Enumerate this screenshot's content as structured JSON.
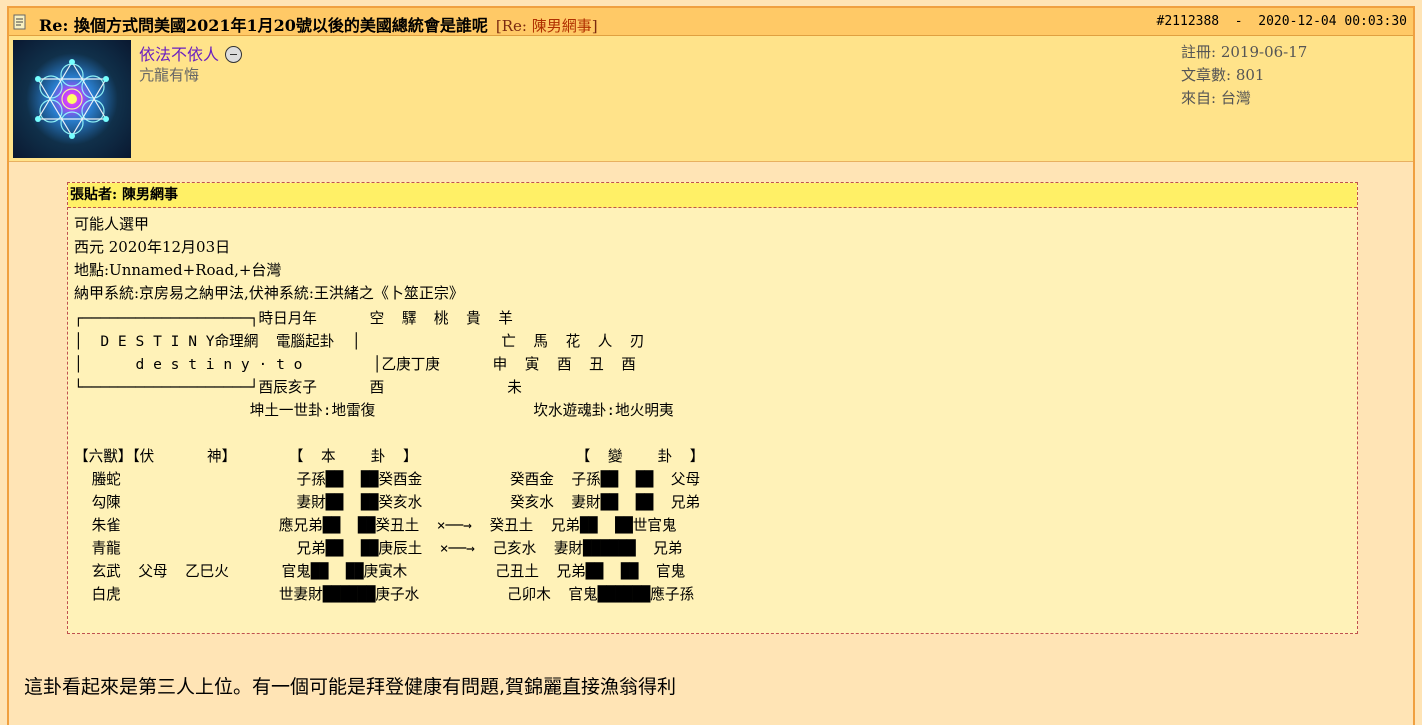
{
  "post": {
    "title": "Re:  換個方式問美國2021年1月20號以後的美國總統會是誰呢",
    "reply_prefix": "[Re:",
    "reply_to": "陳男網事",
    "reply_suffix": "]",
    "id": "#2112388",
    "separator": "-",
    "datetime": "2020-12-04 00:03:30"
  },
  "user": {
    "name": "依法不依人",
    "signature": "亢龍有悔",
    "registered": "註冊: 2019-06-17",
    "posts": "文章數: 801",
    "from": "來自: 台灣"
  },
  "quote": {
    "poster": "張貼者: 陳男網事",
    "lines": [
      "可能人選甲",
      "西元   2020年12月03日",
      "地點:Unnamed+Road,+台灣",
      "納甲系統:京房易之納甲法,伏神系統:王洪緒之《卜筮正宗》"
    ],
    "chart_text": "┌───────────────────┐時日月年      空  驛  桃  貴  羊\n│  D E S T I N Y命理網  電腦起卦  │                亡  馬  花  人  刃\n│      d e s t i n y · t o        │乙庚丁庚      申  寅  酉  丑  酉\n└───────────────────┘酉辰亥子      酉              未\n                    坤土一世卦:地雷復                  坎水遊魂卦:地火明夷\n\n【六獸】【伏      神】      【  本    卦  】                  【  變    卦  】\n  螣蛇                    子孫██  ██癸酉金          癸酉金  子孫██  ██  父母\n  勾陳                    妻財██  ██癸亥水          癸亥水  妻財██  ██  兄弟\n  朱雀                  應兄弟██  ██癸丑土  ×──→  癸丑土  兄弟██  ██世官鬼\n  青龍                    兄弟██  ██庚辰土  ×──→  己亥水  妻財██████  兄弟\n  玄武  父母  乙巳火      官鬼██  ██庚寅木          己丑土  兄弟██  ██  官鬼\n  白虎                  世妻財██████庚子水          己卯木  官鬼██████應子孫"
  },
  "message": "這卦看起來是第三人上位。有一個可能是拜登健康有問題,賀錦麗直接漁翁得利",
  "icons": {
    "title": "document-icon",
    "status": "smiley-icon"
  },
  "colors": {
    "titlebar": "#ffc966",
    "userbar": "#ffe38a",
    "quote_header": "#fff066",
    "username": "#6a20c0"
  }
}
